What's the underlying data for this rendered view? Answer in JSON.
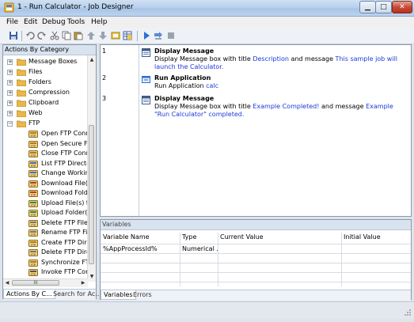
{
  "window": {
    "title": "1 - Run Calculator - Job Designer",
    "buttons": {
      "minimize": "▁",
      "maximize": "□",
      "close": "✕"
    }
  },
  "menu": [
    "File",
    "Edit",
    "Debug",
    "Tools",
    "Help"
  ],
  "toolbar_icons": [
    "save-icon",
    "undo-icon",
    "redo-icon",
    "cut-icon",
    "copy-icon",
    "paste-icon",
    "move-up-icon",
    "move-down-icon",
    "variables-icon",
    "variables-grid-icon",
    "run-icon",
    "step-icon",
    "stop-icon"
  ],
  "left_panel": {
    "header": "Actions By Category",
    "categories": [
      {
        "label": "Message Boxes",
        "expanded": false
      },
      {
        "label": "Files",
        "expanded": false
      },
      {
        "label": "Folders",
        "expanded": false
      },
      {
        "label": "Compression",
        "expanded": false
      },
      {
        "label": "Clipboard",
        "expanded": false
      },
      {
        "label": "Web",
        "expanded": false
      },
      {
        "label": "FTP",
        "expanded": true
      }
    ],
    "ftp_actions": [
      "Open FTP Conne",
      "Open Secure FTF",
      "Close FTP Conne",
      "List FTP Directory",
      "Change Working",
      "Download File(s) f",
      "Download Folder(",
      "Upload File(s) to F",
      "Upload Folder(s) t",
      "Delete FTP File",
      "Rename FTP File",
      "Create FTP Direct",
      "Delete FTP Direct",
      "Synchronize FTP",
      "Invoke FTP Comn"
    ],
    "hscroll_thumb": "III",
    "tabs": [
      "Actions By C...",
      "Search for Ac..."
    ]
  },
  "steps": [
    {
      "num": "1",
      "icon": "message-box-icon",
      "title": "Display Message",
      "desc": [
        {
          "t": "Display Message box with title ",
          "h": false
        },
        {
          "t": "Description",
          "h": true
        },
        {
          "t": " and message ",
          "h": false
        },
        {
          "t": "This sample job will launch the Calculator.",
          "h": true
        }
      ]
    },
    {
      "num": "2",
      "icon": "application-icon",
      "title": "Run Application",
      "desc": [
        {
          "t": "Run Application ",
          "h": false
        },
        {
          "t": "calc",
          "h": true
        }
      ]
    },
    {
      "num": "3",
      "icon": "message-box-icon",
      "title": "Display Message",
      "desc": [
        {
          "t": "Display Message box with title ",
          "h": false
        },
        {
          "t": "Example Completed!",
          "h": true
        },
        {
          "t": " and message ",
          "h": false
        },
        {
          "t": "Example \"Run Calculator\" completed.",
          "h": true
        }
      ]
    }
  ],
  "variables": {
    "header": "Variables",
    "columns": [
      "Variable Name",
      "Type",
      "Current Value",
      "Initial Value"
    ],
    "rows": [
      [
        "%AppProcessId%",
        "Numerical ...",
        "",
        ""
      ]
    ],
    "tabs": [
      "Variables",
      "Errors"
    ]
  },
  "colors": {
    "highlight": "#1c3ad8",
    "titlebar": "#b9d1ec",
    "folder": "#e8b84a"
  }
}
